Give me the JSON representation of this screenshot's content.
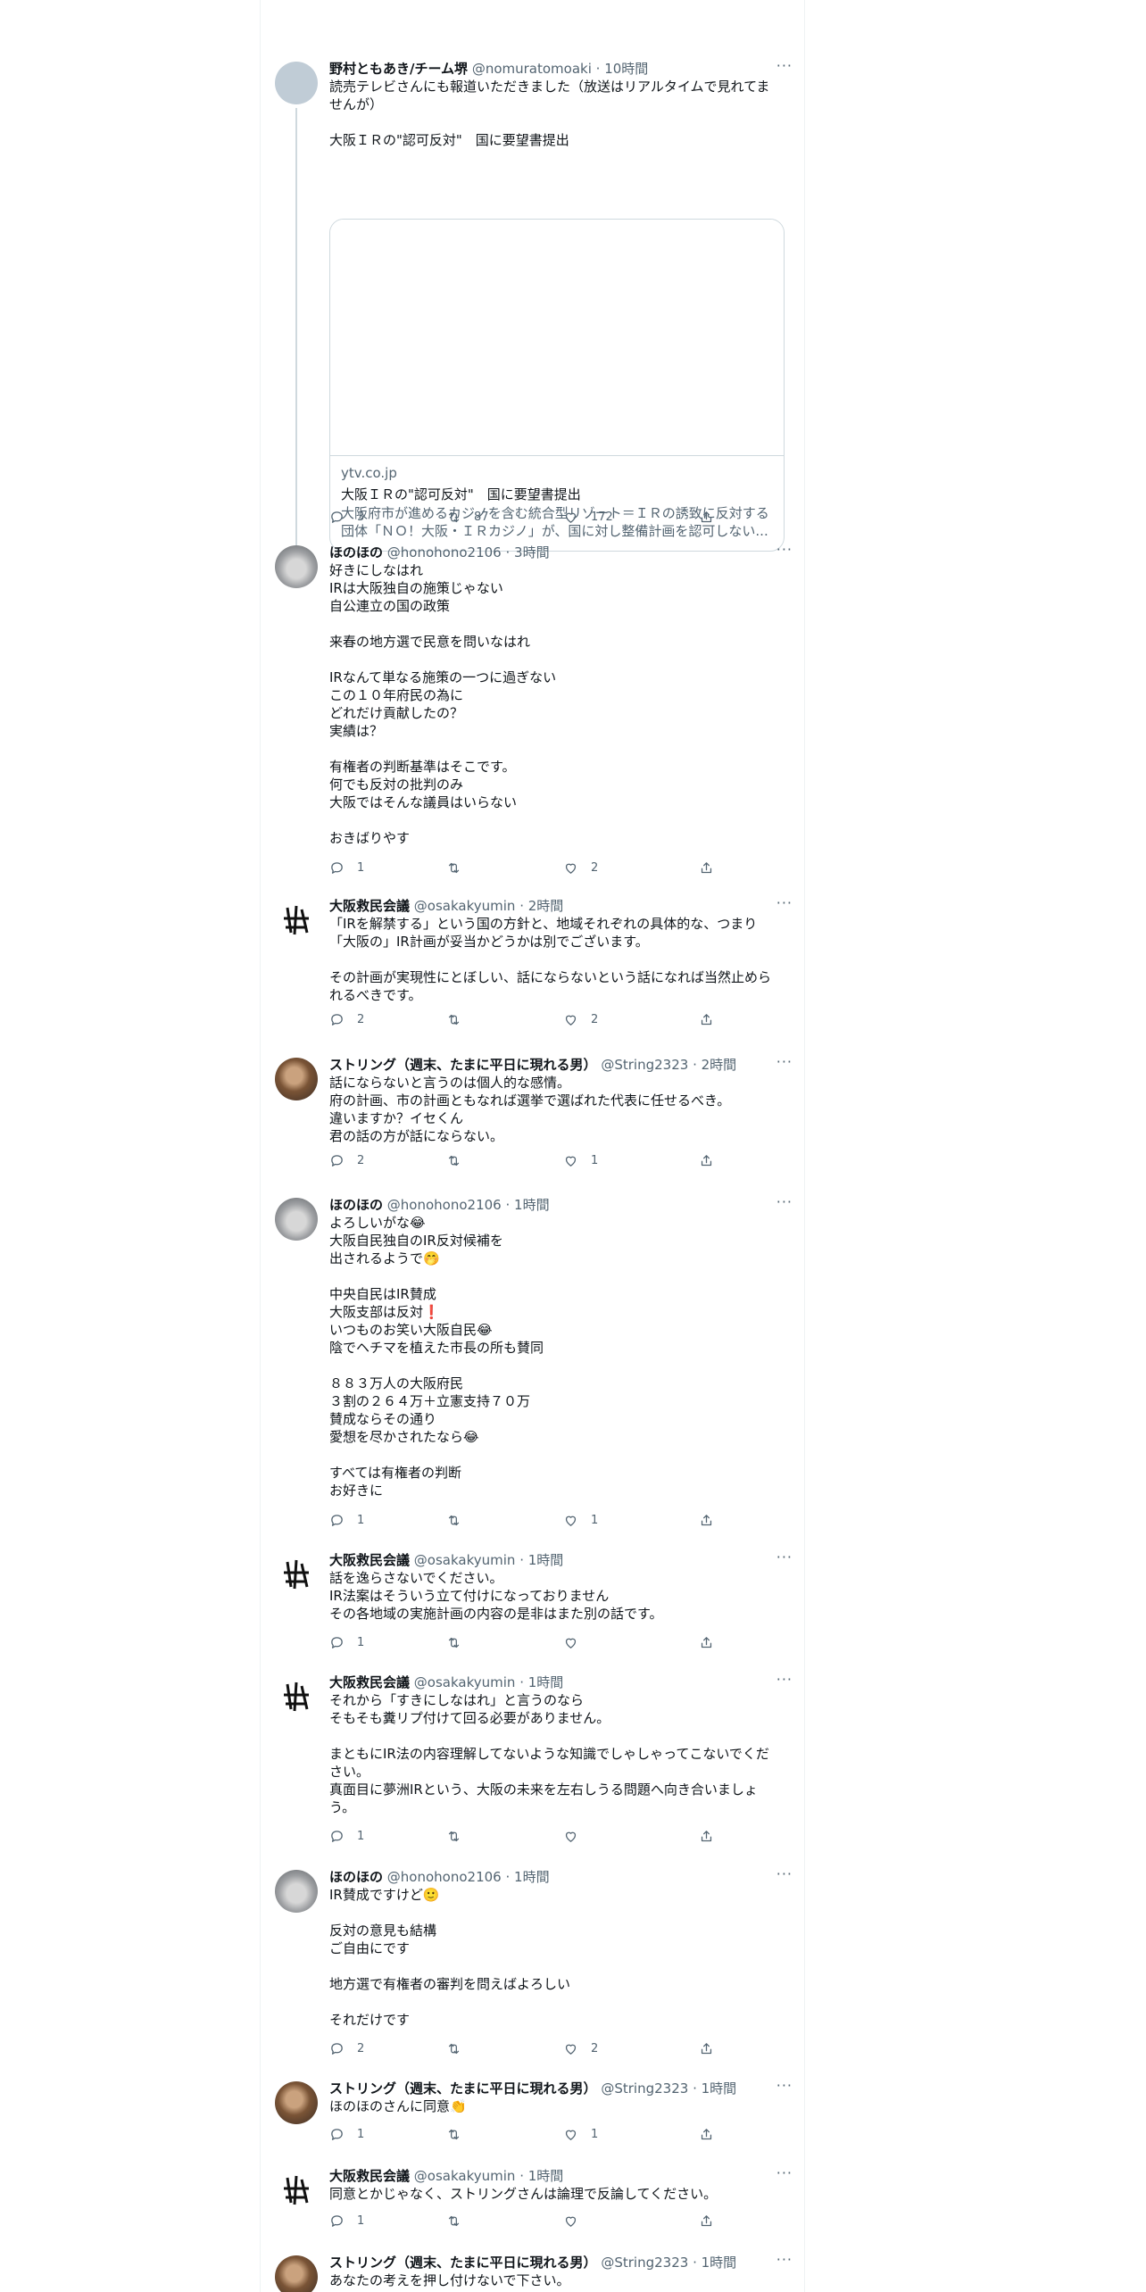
{
  "icons": {
    "reply": "reply-icon",
    "retweet": "retweet-icon",
    "like": "like-icon",
    "share": "share-icon",
    "more": "more-icon"
  },
  "more_label": "···",
  "tweets": [
    {
      "name": "野村ともあき/チーム堺",
      "handle": "@nomuratomoaki",
      "time": "· 10時間",
      "text": "読売テレビさんにも報道いただきました（放送はリアルタイムで見れてま\nせんが）\n\n大阪ＩＲの\"認可反対\"　国に要望書提出",
      "card": {
        "domain": "ytv.co.jp",
        "title": "大阪ＩＲの\"認可反対\"　国に要望書提出",
        "description_line1": "大阪府市が進めるカジノを含む統合型リゾート＝ＩＲの誘致に反対する",
        "description_line2": "団体「ＮＯ！大阪・ＩＲカジノ」が、国に対し整備計画を認可しない..."
      },
      "replies": "3",
      "retweets": "87",
      "likes": "172"
    },
    {
      "name": "ほのほの",
      "handle": "@honohono2106",
      "time": "· 3時間",
      "text": "好きにしなはれ\nIRは大阪独自の施策じゃない\n自公連立の国の政策\n\n来春の地方選で民意を問いなはれ\n\nIRなんて単なる施策の一つに過ぎない\nこの１０年府民の為に\nどれだけ貢献したの？\n実績は？\n\n有権者の判断基準はそこです。\n何でも反対の批判のみ\n大阪ではそんな議員はいらない\n\nおきばりやす",
      "replies": "1",
      "retweets": "",
      "likes": "2"
    },
    {
      "name": "大阪救民会議",
      "handle": "@osakakyumin",
      "time": "· 2時間",
      "text": "「IRを解禁する」という国の方針と、地域それぞれの具体的な、つまり\n「大阪の」IR計画が妥当かどうかは別でございます。\n\nその計画が実現性にとぼしい、話にならないという話になれば当然止めら\nれるべきです。",
      "replies": "2",
      "retweets": "",
      "likes": "2"
    },
    {
      "name": "ストリング（週末、たまに平日に現れる男）",
      "handle": "@String2323",
      "time": "· 2時間",
      "text": "話にならないと言うのは個人的な感情。\n府の計画、市の計画ともなれば選挙で選ばれた代表に任せるべき。\n違いますか？イセくん\n君の話の方が話にならない。",
      "replies": "2",
      "retweets": "",
      "likes": "1"
    },
    {
      "name": "ほのほの",
      "handle": "@honohono2106",
      "time": "· 1時間",
      "text": "よろしいがな😂\n大阪自民独自のIR反対候補を\n出されるようで🤭\n\n中央自民はIR賛成\n大阪支部は反対❗\nいつものお笑い大阪自民😂\n陰でヘチマを植えた市長の所も賛同\n\n８８３万人の大阪府民\n３割の２６４万＋立憲支持７０万\n賛成ならその通り\n愛想を尽かされたなら😂\n\nすべては有権者の判断\nお好きに",
      "replies": "1",
      "retweets": "",
      "likes": "1"
    },
    {
      "name": "大阪救民会議",
      "handle": "@osakakyumin",
      "time": "· 1時間",
      "text": "話を逸らさないでください。\nIR法案はそういう立て付けになっておりません\nその各地域の実施計画の内容の是非はまた別の話です。",
      "replies": "1",
      "retweets": "",
      "likes": ""
    },
    {
      "name": "大阪救民会議",
      "handle": "@osakakyumin",
      "time": "· 1時間",
      "text": "それから「すきにしなはれ」と言うのなら\nそもそも糞リプ付けて回る必要がありません。\n\nまともにIR法の内容理解してないような知識でしゃしゃってこないでくだ\nさい。\n真面目に夢洲IRという、大阪の未来を左右しうる問題へ向き合いましょ\nう。",
      "replies": "1",
      "retweets": "",
      "likes": ""
    },
    {
      "name": "ほのほの",
      "handle": "@honohono2106",
      "time": "· 1時間",
      "text": "IR賛成ですけど🙂\n\n反対の意見も結構\nご自由にです\n\n地方選で有権者の審判を問えばよろしい\n\nそれだけです",
      "replies": "2",
      "retweets": "",
      "likes": "2"
    },
    {
      "name": "ストリング（週末、たまに平日に現れる男）",
      "handle": "@String2323",
      "time": "· 1時間",
      "text": "ほのほのさんに同意👏",
      "replies": "1",
      "retweets": "",
      "likes": "1"
    },
    {
      "name": "大阪救民会議",
      "handle": "@osakakyumin",
      "time": "· 1時間",
      "text": "同意とかじゃなく、ストリングさんは論理で反論してください。",
      "replies": "1",
      "retweets": "",
      "likes": ""
    },
    {
      "name": "ストリング（週末、たまに平日に現れる男）",
      "handle": "@String2323",
      "time": "· 1時間",
      "text": "あなたの考えを押し付けないで下さい。",
      "replies": "",
      "retweets": "",
      "likes": ""
    }
  ]
}
